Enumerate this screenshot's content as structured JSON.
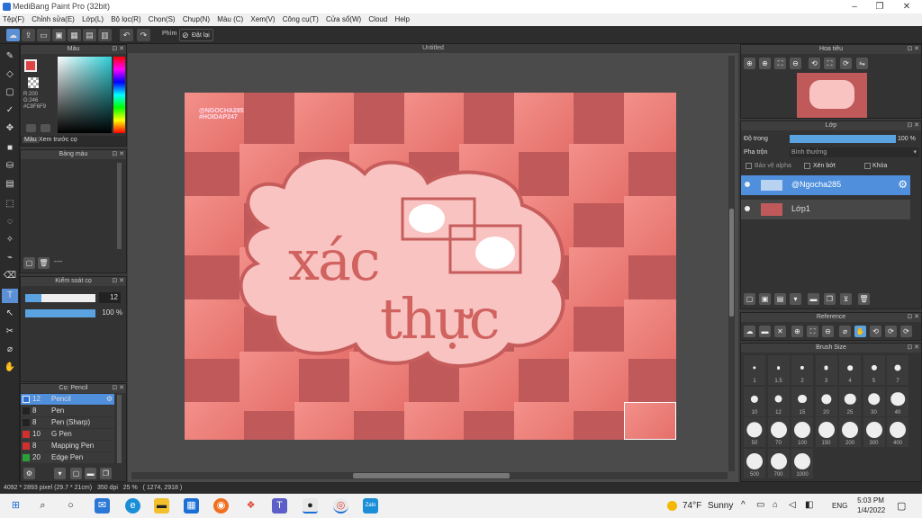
{
  "window": {
    "title": "MediBang Paint Pro (32bit)"
  },
  "menu": [
    "Tệp(F)",
    "Chỉnh sửa(E)",
    "Lớp(L)",
    "Bộ lọc(R)",
    "Chọn(S)",
    "Chụp(N)",
    "Màu (C)",
    "Xem(V)",
    "Công cụ(T)",
    "Cửa sổ(W)",
    "Cloud",
    "Help"
  ],
  "toolbar": {
    "shortcut_label": "Phím",
    "reset_label": "Đặt lại"
  },
  "color_panel": {
    "title": "Màu",
    "r": "R:200",
    "g": "G:246",
    "hex": "#C8F6F9",
    "tab_color": "Màu",
    "tab_preview": "Xem trước cọ"
  },
  "palette_panel": {
    "title": "Bảng màu",
    "dash": "----"
  },
  "brush_control": {
    "title": "Kiểm soát cọ",
    "size": "12",
    "opacity": "100 %"
  },
  "brush_list": {
    "title": "Cọ: Pencil",
    "items": [
      {
        "size": "12",
        "name": "Pencil",
        "color": "#2a6fd6"
      },
      {
        "size": "8",
        "name": "Pen",
        "color": "#222"
      },
      {
        "size": "8",
        "name": "Pen (Sharp)",
        "color": "#222"
      },
      {
        "size": "10",
        "name": "G Pen",
        "color": "#d23030"
      },
      {
        "size": "8",
        "name": "Mapping Pen",
        "color": "#d23030"
      },
      {
        "size": "20",
        "name": "Edge Pen",
        "color": "#2aa03a"
      }
    ]
  },
  "canvas": {
    "tab": "Untitled",
    "watermark_line1": "@NGOCHA285",
    "watermark_line2": "#HOIDAP247",
    "text_line1": "xác",
    "text_line2": "thực"
  },
  "navigator": {
    "title": "Hoa tiêu"
  },
  "layer_panel": {
    "title": "Lớp",
    "opacity_label": "Độ trong",
    "opacity_value": "100 %",
    "opacity_fraction": 1.0,
    "blend_label": "Pha trộn",
    "blend_value": "Bình thường",
    "protect_alpha": "Bảo vệ alpha",
    "clipping": "Xén bớt",
    "lock": "Khóa",
    "layers": [
      {
        "name": "@Ngocha285",
        "selected": true
      },
      {
        "name": "Lớp1",
        "selected": false
      }
    ]
  },
  "reference": {
    "title": "Reference"
  },
  "brush_size": {
    "title": "Brush Size",
    "sizes": [
      "1",
      "1.5",
      "2",
      "3",
      "4",
      "5",
      "7",
      "10",
      "12",
      "15",
      "20",
      "25",
      "30",
      "40",
      "50",
      "70",
      "100",
      "150",
      "200",
      "300",
      "400",
      "500",
      "700",
      "1000"
    ]
  },
  "status": {
    "dimensions": "4092 * 2893 pixel",
    "paper": "(29.7 * 21cm)",
    "dpi": "350 dpi",
    "zoom": "25 %",
    "coords": "( 1274, 2918 )"
  },
  "taskbar": {
    "weather_temp": "74°F",
    "weather_text": "Sunny",
    "lang": "ENG",
    "time": "5:03 PM",
    "date": "1/4/2022"
  }
}
